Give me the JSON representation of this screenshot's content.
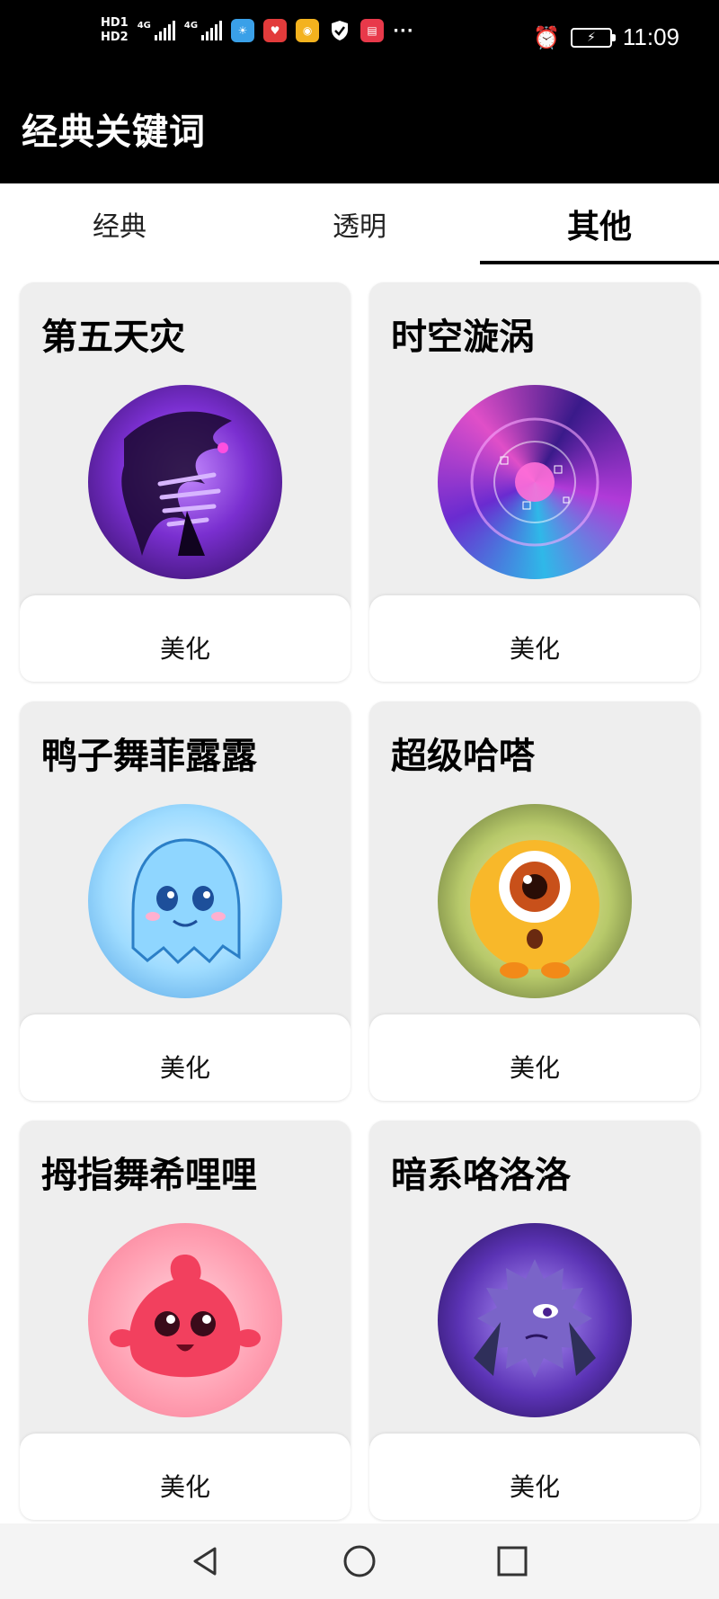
{
  "status_bar": {
    "hd1": "HD1",
    "hd2": "HD2",
    "net1": "4G",
    "net2": "4G",
    "more": "···",
    "time": "11:09",
    "icons": [
      "weather-app-icon",
      "store-app-icon",
      "weibo-icon",
      "shield-icon",
      "book-app-icon",
      "alarm-icon",
      "battery-charging-icon"
    ]
  },
  "app_bar": {
    "title": "经典关键词"
  },
  "tabs": [
    {
      "label": "经典",
      "active": false
    },
    {
      "label": "透明",
      "active": false
    },
    {
      "label": "其他",
      "active": true
    }
  ],
  "cards": [
    {
      "title": "第五天灾",
      "action": "美化",
      "theme": "#6a2bb8"
    },
    {
      "title": "时空漩涡",
      "action": "美化",
      "theme": "#7a3ad0"
    },
    {
      "title": "鸭子舞菲露露",
      "action": "美化",
      "theme": "#5ab4f0"
    },
    {
      "title": "超级哈嗒",
      "action": "美化",
      "theme": "#f2b62a"
    },
    {
      "title": "拇指舞希哩哩",
      "action": "美化",
      "theme": "#f56a85"
    },
    {
      "title": "暗系咯洛洛",
      "action": "美化",
      "theme": "#5b33b5"
    }
  ],
  "nav_bar": {
    "icons": [
      "back-triangle-icon",
      "home-circle-icon",
      "recents-square-icon"
    ]
  }
}
